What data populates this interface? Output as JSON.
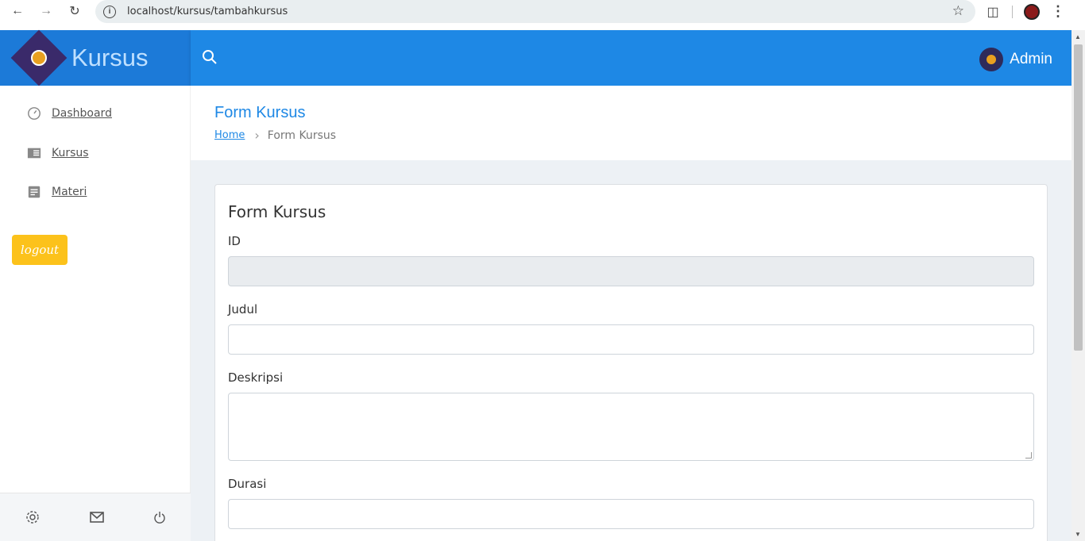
{
  "browser": {
    "url": "localhost/kursus/tambahkursus"
  },
  "header": {
    "brand": "Kursus",
    "user_name": "Admin"
  },
  "sidebar": {
    "items": [
      {
        "label": "Dashboard",
        "icon": "dashboard-icon"
      },
      {
        "label": "Kursus",
        "icon": "book-icon"
      },
      {
        "label": "Materi",
        "icon": "document-icon"
      }
    ],
    "logout_label": "logout",
    "footer_icons": [
      "settings-icon",
      "mail-icon",
      "power-icon"
    ]
  },
  "page": {
    "title": "Form Kursus",
    "breadcrumb": {
      "home": "Home",
      "current": "Form Kursus"
    }
  },
  "form": {
    "title": "Form Kursus",
    "fields": [
      {
        "label": "ID",
        "value": "",
        "disabled": true
      },
      {
        "label": "Judul",
        "value": ""
      },
      {
        "label": "Deskripsi",
        "value": "",
        "type": "textarea"
      },
      {
        "label": "Durasi",
        "value": ""
      }
    ]
  },
  "colors": {
    "primary": "#1e88e5",
    "brand_bg": "#1c7ad8",
    "logout": "#fcc21b",
    "content_bg": "#edf1f5"
  }
}
